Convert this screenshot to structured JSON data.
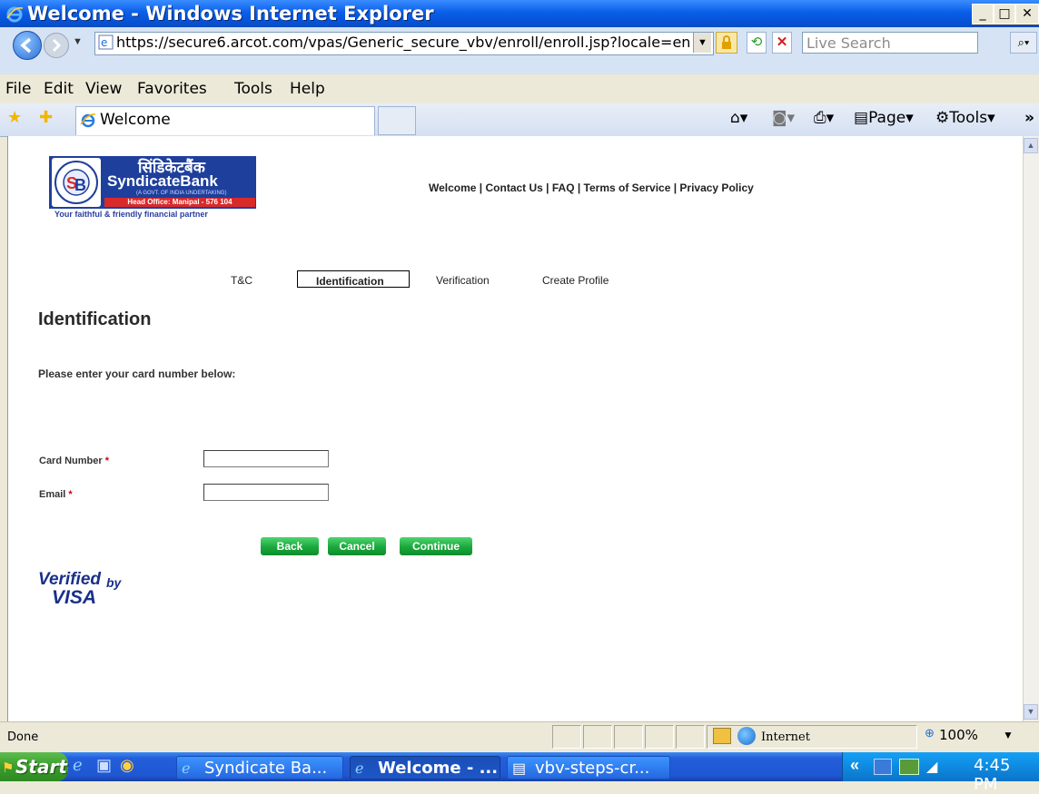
{
  "window": {
    "title": "Welcome - Windows Internet Explorer"
  },
  "address_bar": {
    "url": "https://secure6.arcot.com/vpas/Generic_secure_vbv/enroll/enroll.jsp?locale=en",
    "search_placeholder": "Live Search"
  },
  "menu": [
    "File",
    "Edit",
    "View",
    "Favorites",
    "Tools",
    "Help"
  ],
  "tab": {
    "label": "Welcome"
  },
  "commands": {
    "page": "Page",
    "tools": "Tools"
  },
  "bank": {
    "hindi_name": "सिंडिकेटबैंक",
    "name": "SyndicateBank",
    "govt_note": "(A GOVT. OF INDIA UNDERTAKING)",
    "head_office": "Head Office: Manipal - 576 104",
    "tagline": "Your faithful & friendly financial partner"
  },
  "top_links": "Welcome | Contact Us | FAQ | Terms of Service | Privacy Policy",
  "steps": [
    "T&C",
    "Identification",
    "Verification",
    "Create Profile"
  ],
  "page_title": "Identification",
  "instructions": "Please enter your card number below:",
  "form": {
    "card_label": "Card Number",
    "email_label": "Email",
    "required_mark": "*",
    "card_value": "",
    "email_value": ""
  },
  "buttons": {
    "back": "Back",
    "cancel": "Cancel",
    "continue": "Continue"
  },
  "vbv": {
    "line1": "Verified",
    "line2": "by",
    "line3": "VISA"
  },
  "status": {
    "text": "Done",
    "zone": "Internet",
    "zoom": "100%"
  },
  "taskbar": {
    "start": "Start",
    "items": [
      "Syndicate Ba...",
      "Welcome - ...",
      "vbv-steps-cr..."
    ],
    "clock": "4:45 PM",
    "tray_arrow": "«"
  },
  "colors": {
    "bank_blue": "#1f3f9c",
    "button_green": "#1aa83c",
    "required_red": "#cc0000",
    "xp_blue": "#0a5ee8"
  }
}
